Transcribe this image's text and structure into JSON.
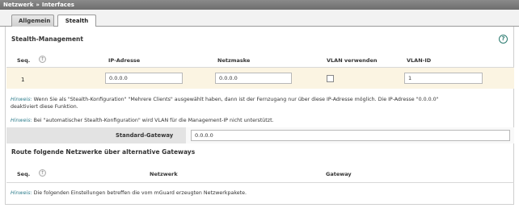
{
  "breadcrumb": {
    "part1": "Netzwerk",
    "sep": "»",
    "part2": "Interfaces"
  },
  "tabs": [
    {
      "label": "Allgemein"
    },
    {
      "label": "Stealth"
    }
  ],
  "stealth": {
    "title": "Stealth-Management",
    "help_glyph": "?",
    "columns": {
      "seq": "Seq.",
      "ip": "IP-Adresse",
      "mask": "Netzmaske",
      "vlan_use": "VLAN verwenden",
      "vlan_id": "VLAN-ID"
    },
    "row": {
      "seq": "1",
      "ip": "0.0.0.0",
      "mask": "0.0.0.0",
      "vlan_checked": false,
      "vlan_id": "1"
    }
  },
  "hints": {
    "keyword": "Hinweis:",
    "hint1_line1": "Wenn Sie als \"Stealth-Konfiguration\" \"Mehrere Clients\" ausgewählt haben, dann ist der Fernzugang nur über diese IP-Adresse möglich. Die IP-Adresse \"0.0.0.0\"",
    "hint1_line2": "deaktiviert diese Funktion.",
    "hint2": "Bei \"automatischer Stealth-Konfiguration\" wird VLAN für die Management-IP nicht unterstützt.",
    "hint3": "Die folgenden Einstellungen betreffen die vom mGuard erzeugten Netzwerkpakete."
  },
  "gateway": {
    "label": "Standard-Gateway",
    "value": "0.0.0.0"
  },
  "routes": {
    "title": "Route folgende Netzwerke über alternative Gateways",
    "columns": {
      "seq": "Seq.",
      "network": "Netzwerk",
      "gateway": "Gateway"
    }
  },
  "colors": {
    "accent": "#2e7d8c",
    "row_highlight": "#fbf4e2",
    "titlebar": "#7a7a7a"
  }
}
